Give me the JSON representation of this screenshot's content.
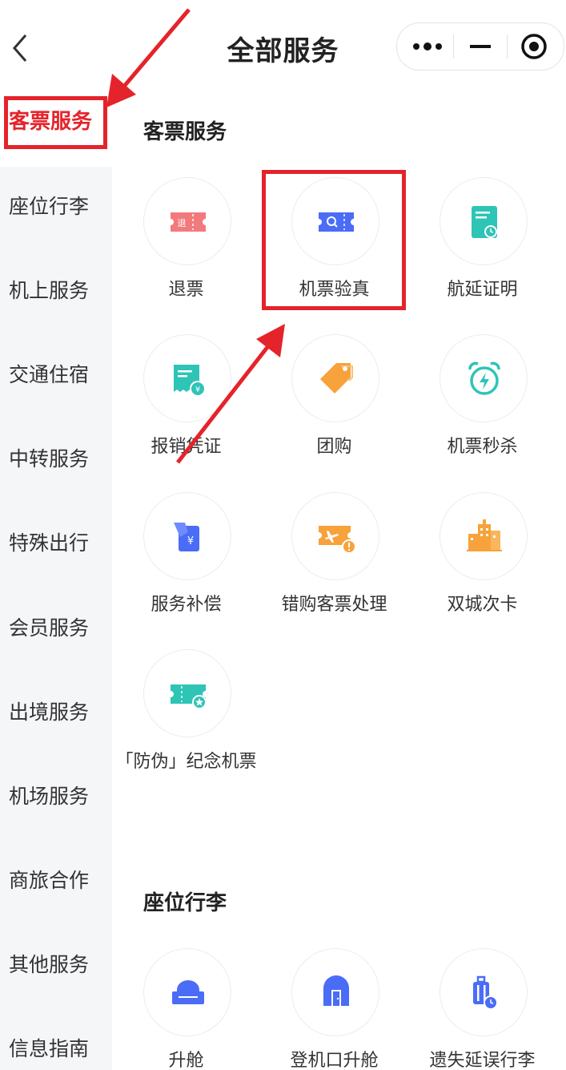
{
  "header": {
    "title": "全部服务"
  },
  "sidebar": {
    "items": [
      {
        "label": "客票服务"
      },
      {
        "label": "座位行李"
      },
      {
        "label": "机上服务"
      },
      {
        "label": "交通住宿"
      },
      {
        "label": "中转服务"
      },
      {
        "label": "特殊出行"
      },
      {
        "label": "会员服务"
      },
      {
        "label": "出境服务"
      },
      {
        "label": "机场服务"
      },
      {
        "label": "商旅合作"
      },
      {
        "label": "其他服务"
      },
      {
        "label": "信息指南"
      }
    ]
  },
  "sections": [
    {
      "title": "客票服务",
      "items": [
        {
          "label": "退票",
          "icon": "refund-ticket-icon"
        },
        {
          "label": "机票验真",
          "icon": "ticket-verify-icon"
        },
        {
          "label": "航延证明",
          "icon": "delay-certificate-icon"
        },
        {
          "label": "报销凭证",
          "icon": "reimbursement-receipt-icon"
        },
        {
          "label": "团购",
          "icon": "group-buy-tag-icon"
        },
        {
          "label": "机票秒杀",
          "icon": "flash-sale-alarm-icon"
        },
        {
          "label": "服务补偿",
          "icon": "compensation-icon"
        },
        {
          "label": "错购客票处理",
          "icon": "wrong-ticket-icon"
        },
        {
          "label": "双城次卡",
          "icon": "dual-city-card-icon"
        },
        {
          "label": "「防伪」纪念机票",
          "icon": "souvenir-ticket-icon"
        }
      ]
    },
    {
      "title": "座位行李",
      "items": [
        {
          "label": "升舱",
          "icon": "seat-upgrade-icon"
        },
        {
          "label": "登机口升舱",
          "icon": "gate-upgrade-icon"
        },
        {
          "label": "遗失延误行李",
          "icon": "lost-luggage-icon"
        }
      ]
    }
  ],
  "colors": {
    "accent": "#e5232a",
    "blue": "#4a6cf7",
    "teal": "#2ec4b6",
    "orange": "#f7a23b",
    "pink": "#f27a7d"
  }
}
